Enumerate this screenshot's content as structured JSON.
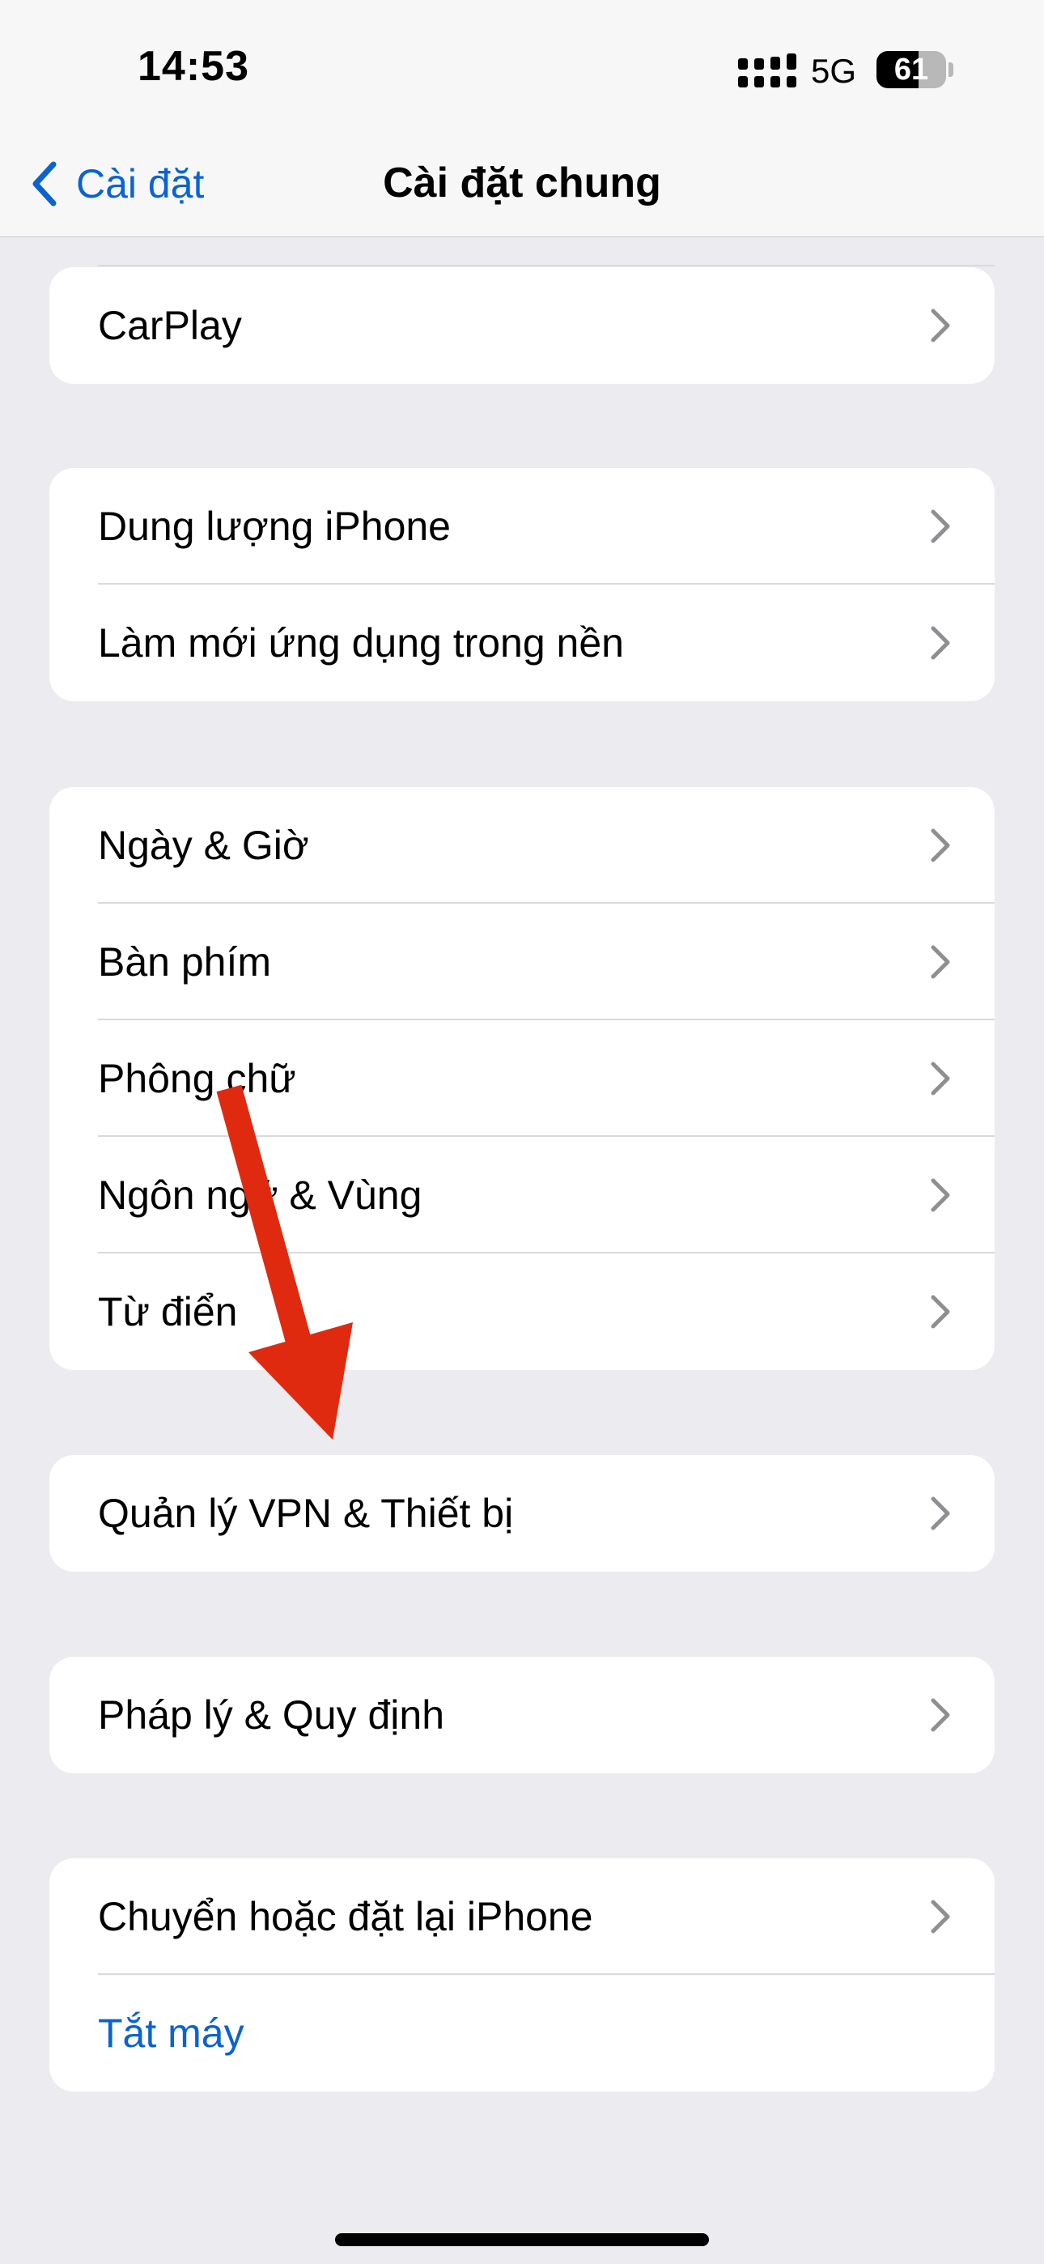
{
  "status_bar": {
    "time": "14:53",
    "network": "5G",
    "battery_level": 61,
    "battery_text": "61"
  },
  "nav": {
    "back_label": "Cài đặt",
    "title": "Cài đặt chung"
  },
  "groups": [
    {
      "items": [
        {
          "label": "CarPlay"
        }
      ]
    },
    {
      "items": [
        {
          "label": "Dung lượng iPhone"
        },
        {
          "label": "Làm mới ứng dụng trong nền"
        }
      ]
    },
    {
      "items": [
        {
          "label": "Ngày & Giờ"
        },
        {
          "label": "Bàn phím"
        },
        {
          "label": "Phông chữ"
        },
        {
          "label": "Ngôn ngữ & Vùng"
        },
        {
          "label": "Từ điển"
        }
      ]
    },
    {
      "items": [
        {
          "label": "Quản lý VPN & Thiết bị"
        }
      ]
    },
    {
      "items": [
        {
          "label": "Pháp lý & Quy định"
        }
      ]
    },
    {
      "items": [
        {
          "label": "Chuyển hoặc đặt lại iPhone"
        },
        {
          "label": "Tắt máy"
        }
      ]
    }
  ],
  "colors": {
    "accent": "#0a63d1",
    "annotation_arrow": "#e02a10",
    "background": "#ebebf0"
  },
  "icons": {
    "back": "chevron-left-icon",
    "row": "chevron-right-icon",
    "signal": "cellular-signal-icon",
    "battery": "battery-icon"
  }
}
